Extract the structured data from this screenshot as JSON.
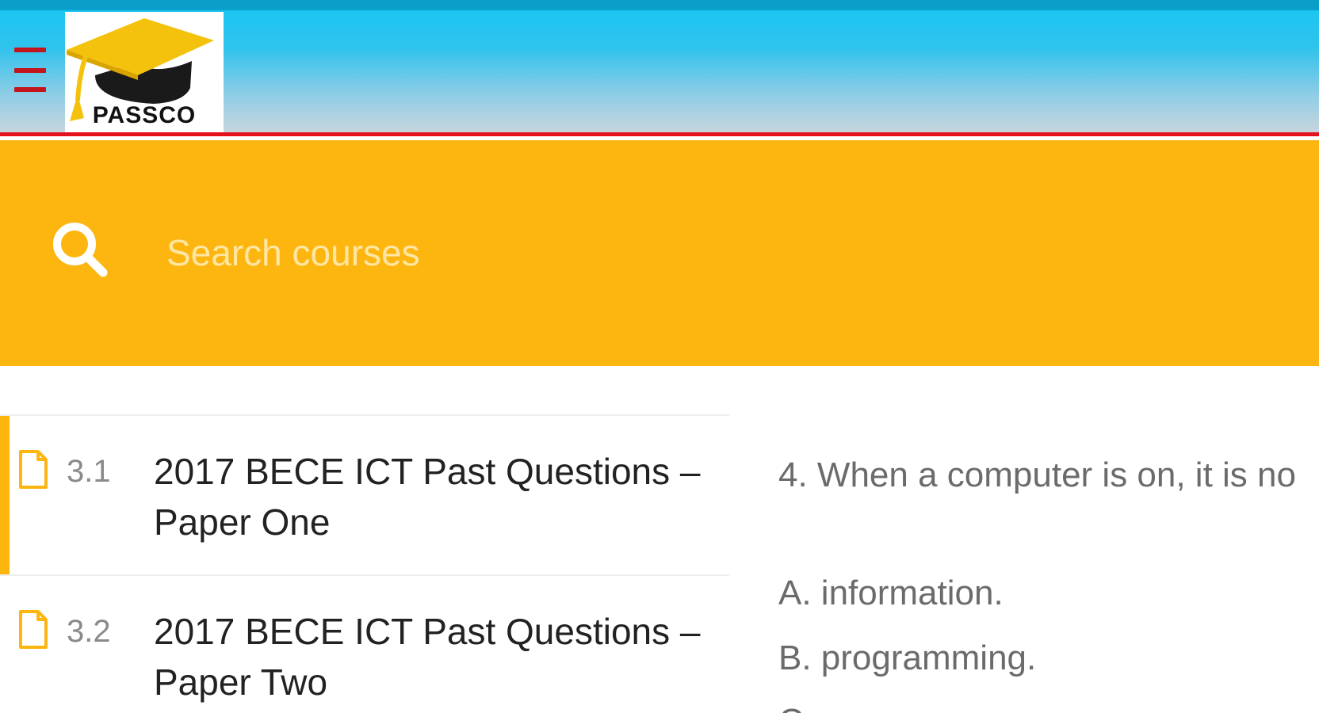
{
  "header": {
    "logo_text": "PASSCO",
    "menu_icon": "hamburger-menu-icon",
    "colors": {
      "top_bar": "#0a9fc9",
      "bottom_border": "#e3121b",
      "menu_icon": "#c2151c"
    }
  },
  "search": {
    "placeholder": "Search courses",
    "icon": "search-icon",
    "band_color": "#fdb510"
  },
  "course_list": {
    "items": [
      {
        "number": "3.1",
        "title": "2017 BECE ICT Past Questions – Paper One",
        "active": true
      },
      {
        "number": "3.2",
        "title": "2017 BECE ICT Past Questions – Paper Two",
        "active": false
      }
    ]
  },
  "question": {
    "text": "4. When a computer is on, it is no",
    "options": [
      "A. information.",
      "B. programming.",
      "C. ..."
    ]
  }
}
